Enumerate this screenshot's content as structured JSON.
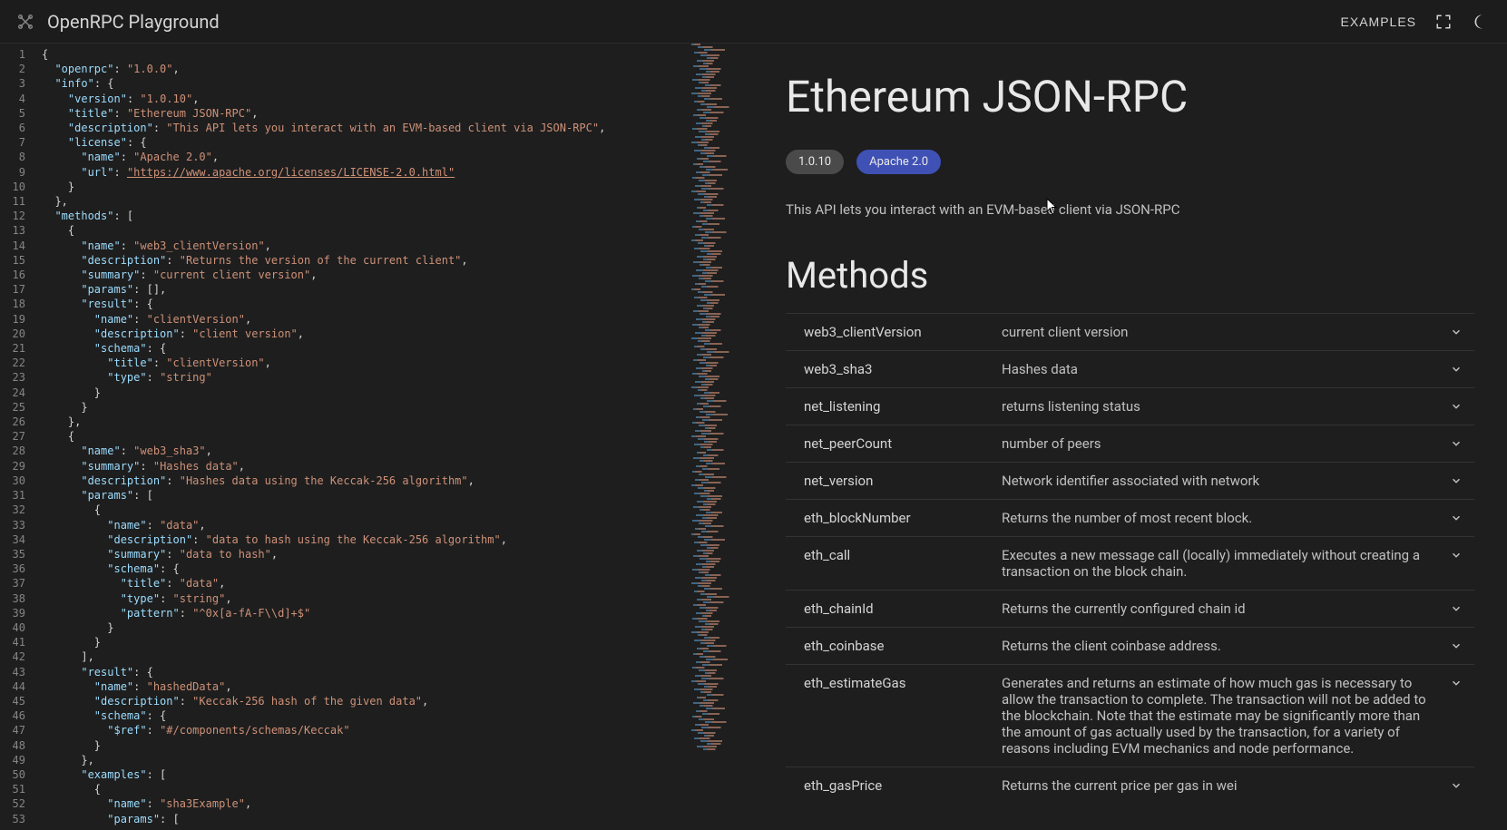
{
  "topbar": {
    "app_title": "OpenRPC Playground",
    "examples_label": "EXAMPLES"
  },
  "doc": {
    "title": "Ethereum JSON-RPC",
    "version_badge": "1.0.10",
    "license_badge": "Apache 2.0",
    "description": "This API lets you interact with an EVM-based client via JSON-RPC",
    "methods_heading": "Methods",
    "methods": [
      {
        "name": "web3_clientVersion",
        "summary": "current client version"
      },
      {
        "name": "web3_sha3",
        "summary": "Hashes data"
      },
      {
        "name": "net_listening",
        "summary": "returns listening status"
      },
      {
        "name": "net_peerCount",
        "summary": "number of peers"
      },
      {
        "name": "net_version",
        "summary": "Network identifier associated with network"
      },
      {
        "name": "eth_blockNumber",
        "summary": "Returns the number of most recent block."
      },
      {
        "name": "eth_call",
        "summary": "Executes a new message call (locally) immediately without creating a transaction on the block chain."
      },
      {
        "name": "eth_chainId",
        "summary": "Returns the currently configured chain id"
      },
      {
        "name": "eth_coinbase",
        "summary": "Returns the client coinbase address."
      },
      {
        "name": "eth_estimateGas",
        "summary": "Generates and returns an estimate of how much gas is necessary to allow the transaction to complete. The transaction will not be added to the blockchain. Note that the estimate may be significantly more than the amount of gas actually used by the transaction, for a variety of reasons including EVM mechanics and node performance."
      },
      {
        "name": "eth_gasPrice",
        "summary": "Returns the current price per gas in wei"
      }
    ]
  },
  "editor": {
    "line_count": 53,
    "lines": [
      {
        "i": 0,
        "t": "{"
      },
      {
        "i": 1,
        "t": "  \"openrpc\": \"1.0.0\",",
        "keys": [
          "openrpc"
        ],
        "vals": [
          "1.0.0"
        ]
      },
      {
        "i": 1,
        "t": "  \"info\": {",
        "keys": [
          "info"
        ]
      },
      {
        "i": 2,
        "t": "    \"version\": \"1.0.10\",",
        "keys": [
          "version"
        ],
        "vals": [
          "1.0.10"
        ]
      },
      {
        "i": 2,
        "t": "    \"title\": \"Ethereum JSON-RPC\",",
        "keys": [
          "title"
        ],
        "vals": [
          "Ethereum JSON-RPC"
        ]
      },
      {
        "i": 2,
        "t": "    \"description\": \"This API lets you interact with an EVM-based client via JSON-RPC\",",
        "keys": [
          "description"
        ],
        "vals": [
          "This API lets you interact with an EVM-based client via JSON-RPC"
        ]
      },
      {
        "i": 2,
        "t": "    \"license\": {",
        "keys": [
          "license"
        ]
      },
      {
        "i": 3,
        "t": "      \"name\": \"Apache 2.0\",",
        "keys": [
          "name"
        ],
        "vals": [
          "Apache 2.0"
        ]
      },
      {
        "i": 3,
        "t": "      \"url\": \"https://www.apache.org/licenses/LICENSE-2.0.html\"",
        "keys": [
          "url"
        ],
        "vals": [
          "https://www.apache.org/licenses/LICENSE-2.0.html"
        ],
        "underline": true
      },
      {
        "i": 2,
        "t": "    }"
      },
      {
        "i": 1,
        "t": "  },"
      },
      {
        "i": 1,
        "t": "  \"methods\": [",
        "keys": [
          "methods"
        ]
      },
      {
        "i": 2,
        "t": "    {"
      },
      {
        "i": 3,
        "t": "      \"name\": \"web3_clientVersion\",",
        "keys": [
          "name"
        ],
        "vals": [
          "web3_clientVersion"
        ]
      },
      {
        "i": 3,
        "t": "      \"description\": \"Returns the version of the current client\",",
        "keys": [
          "description"
        ],
        "vals": [
          "Returns the version of the current client"
        ]
      },
      {
        "i": 3,
        "t": "      \"summary\": \"current client version\",",
        "keys": [
          "summary"
        ],
        "vals": [
          "current client version"
        ]
      },
      {
        "i": 3,
        "t": "      \"params\": [],",
        "keys": [
          "params"
        ]
      },
      {
        "i": 3,
        "t": "      \"result\": {",
        "keys": [
          "result"
        ]
      },
      {
        "i": 4,
        "t": "        \"name\": \"clientVersion\",",
        "keys": [
          "name"
        ],
        "vals": [
          "clientVersion"
        ]
      },
      {
        "i": 4,
        "t": "        \"description\": \"client version\",",
        "keys": [
          "description"
        ],
        "vals": [
          "client version"
        ]
      },
      {
        "i": 4,
        "t": "        \"schema\": {",
        "keys": [
          "schema"
        ]
      },
      {
        "i": 5,
        "t": "          \"title\": \"clientVersion\",",
        "keys": [
          "title"
        ],
        "vals": [
          "clientVersion"
        ]
      },
      {
        "i": 5,
        "t": "          \"type\": \"string\"",
        "keys": [
          "type"
        ],
        "vals": [
          "string"
        ]
      },
      {
        "i": 4,
        "t": "        }"
      },
      {
        "i": 3,
        "t": "      }"
      },
      {
        "i": 2,
        "t": "    },"
      },
      {
        "i": 2,
        "t": "    {"
      },
      {
        "i": 3,
        "t": "      \"name\": \"web3_sha3\",",
        "keys": [
          "name"
        ],
        "vals": [
          "web3_sha3"
        ]
      },
      {
        "i": 3,
        "t": "      \"summary\": \"Hashes data\",",
        "keys": [
          "summary"
        ],
        "vals": [
          "Hashes data"
        ]
      },
      {
        "i": 3,
        "t": "      \"description\": \"Hashes data using the Keccak-256 algorithm\",",
        "keys": [
          "description"
        ],
        "vals": [
          "Hashes data using the Keccak-256 algorithm"
        ]
      },
      {
        "i": 3,
        "t": "      \"params\": [",
        "keys": [
          "params"
        ]
      },
      {
        "i": 4,
        "t": "        {"
      },
      {
        "i": 5,
        "t": "          \"name\": \"data\",",
        "keys": [
          "name"
        ],
        "vals": [
          "data"
        ]
      },
      {
        "i": 5,
        "t": "          \"description\": \"data to hash using the Keccak-256 algorithm\",",
        "keys": [
          "description"
        ],
        "vals": [
          "data to hash using the Keccak-256 algorithm"
        ]
      },
      {
        "i": 5,
        "t": "          \"summary\": \"data to hash\",",
        "keys": [
          "summary"
        ],
        "vals": [
          "data to hash"
        ]
      },
      {
        "i": 5,
        "t": "          \"schema\": {",
        "keys": [
          "schema"
        ]
      },
      {
        "i": 6,
        "t": "            \"title\": \"data\",",
        "keys": [
          "title"
        ],
        "vals": [
          "data"
        ]
      },
      {
        "i": 6,
        "t": "            \"type\": \"string\",",
        "keys": [
          "type"
        ],
        "vals": [
          "string"
        ]
      },
      {
        "i": 6,
        "t": "            \"pattern\": \"^0x[a-fA-F\\\\d]+$\"",
        "keys": [
          "pattern"
        ],
        "vals": [
          "^0x[a-fA-F\\\\d]+$"
        ]
      },
      {
        "i": 5,
        "t": "          }"
      },
      {
        "i": 4,
        "t": "        }"
      },
      {
        "i": 3,
        "t": "      ],"
      },
      {
        "i": 3,
        "t": "      \"result\": {",
        "keys": [
          "result"
        ]
      },
      {
        "i": 4,
        "t": "        \"name\": \"hashedData\",",
        "keys": [
          "name"
        ],
        "vals": [
          "hashedData"
        ]
      },
      {
        "i": 4,
        "t": "        \"description\": \"Keccak-256 hash of the given data\",",
        "keys": [
          "description"
        ],
        "vals": [
          "Keccak-256 hash of the given data"
        ]
      },
      {
        "i": 4,
        "t": "        \"schema\": {",
        "keys": [
          "schema"
        ]
      },
      {
        "i": 5,
        "t": "          \"$ref\": \"#/components/schemas/Keccak\"",
        "keys": [
          "$ref"
        ],
        "vals": [
          "#/components/schemas/Keccak"
        ]
      },
      {
        "i": 4,
        "t": "        }"
      },
      {
        "i": 3,
        "t": "      },"
      },
      {
        "i": 3,
        "t": "      \"examples\": [",
        "keys": [
          "examples"
        ]
      },
      {
        "i": 4,
        "t": "        {"
      },
      {
        "i": 5,
        "t": "          \"name\": \"sha3Example\",",
        "keys": [
          "name"
        ],
        "vals": [
          "sha3Example"
        ]
      },
      {
        "i": 5,
        "t": "          \"params\": [",
        "keys": [
          "params"
        ]
      }
    ]
  }
}
